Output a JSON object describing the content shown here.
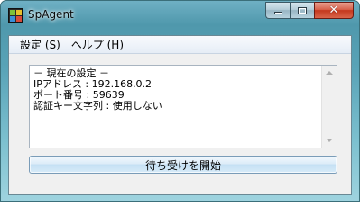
{
  "window": {
    "title": "SpAgent",
    "caption_buttons": {
      "minimize": "minimize-icon",
      "maximize": "maximize-icon",
      "close": "close-icon"
    }
  },
  "menubar": {
    "items": [
      {
        "label": "設定 (S)"
      },
      {
        "label": "ヘルプ (H)"
      }
    ]
  },
  "status": {
    "lines": [
      "－ 現在の設定 －",
      "IPアドレス : 192.168.0.2",
      "ポート番号 : 59639",
      "認証キー文字列 : 使用しない"
    ]
  },
  "actions": {
    "start_label": "待ち受けを開始"
  },
  "colors": {
    "titlebar_accent": "#5aa4b8",
    "close_button": "#c4381e",
    "client_background": "#f0f0f0"
  }
}
